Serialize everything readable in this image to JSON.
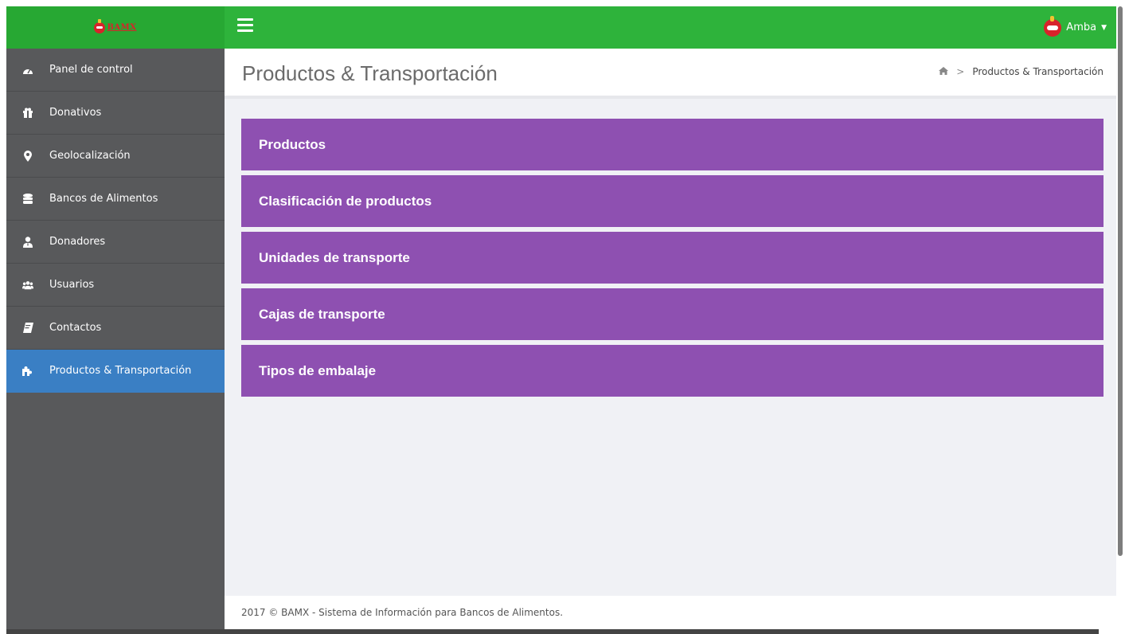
{
  "header": {
    "brand_text": "BAMX",
    "user_name": "Amba",
    "colors": {
      "header": "#2eb33b",
      "brand_bg": "#27a833"
    }
  },
  "sidebar": {
    "items": [
      {
        "label": "Panel de control",
        "icon": "tachometer-icon",
        "active": false
      },
      {
        "label": "Donativos",
        "icon": "gift-icon",
        "active": false
      },
      {
        "label": "Geolocalización",
        "icon": "map-marker-icon",
        "active": false
      },
      {
        "label": "Bancos de Alimentos",
        "icon": "database-icon",
        "active": false
      },
      {
        "label": "Donadores",
        "icon": "user-tie-icon",
        "active": false
      },
      {
        "label": "Usuarios",
        "icon": "users-icon",
        "active": false
      },
      {
        "label": "Contactos",
        "icon": "address-book-icon",
        "active": false
      },
      {
        "label": "Productos & Transportación",
        "icon": "puzzle-icon",
        "active": true
      }
    ],
    "colors": {
      "bg": "#58595b",
      "active": "#3a7fc4"
    }
  },
  "main": {
    "title": "Productos & Transportación",
    "breadcrumb": {
      "home_icon": "home-icon",
      "separator": ">",
      "current": "Productos & Transportación"
    },
    "tiles": [
      "Productos",
      "Clasificación de productos",
      "Unidades de transporte",
      "Cajas de transporte",
      "Tipos de embalaje"
    ],
    "colors": {
      "tile": "#8e50b1",
      "content_bg": "#f0f1f5"
    }
  },
  "footer": {
    "text": "2017 © BAMX - Sistema de Información para Bancos de Alimentos."
  }
}
